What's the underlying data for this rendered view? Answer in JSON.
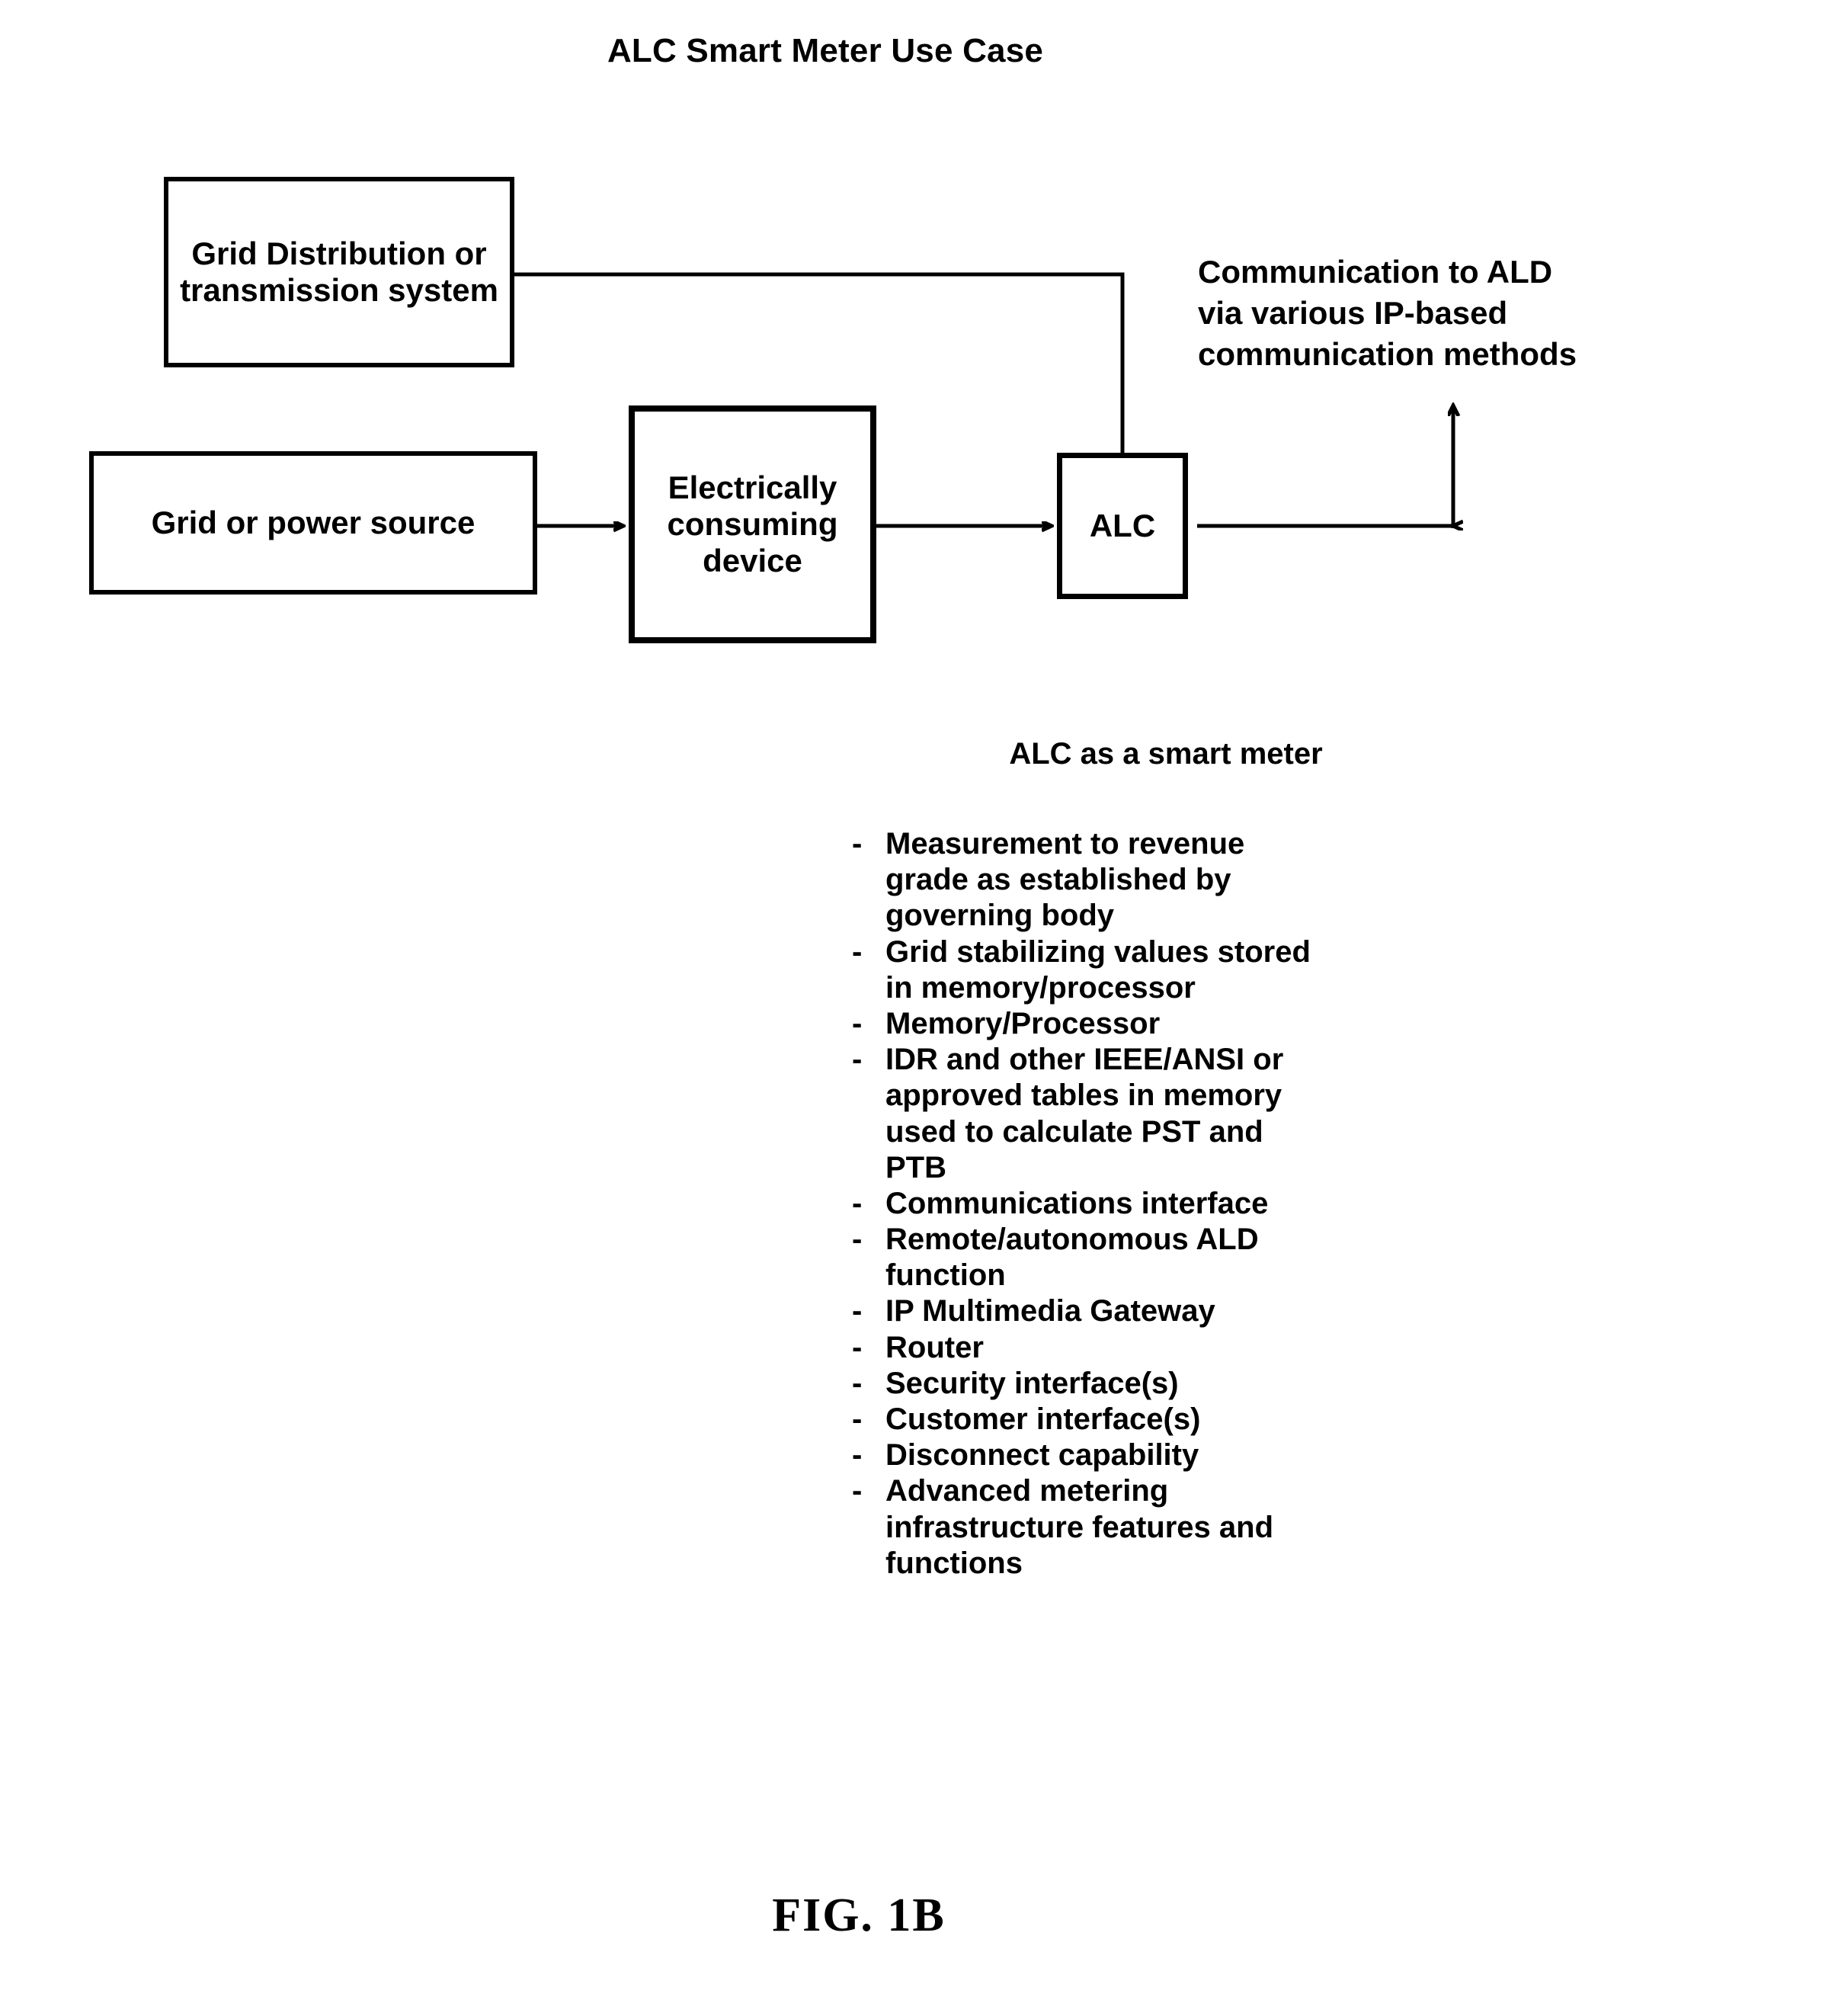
{
  "figure": {
    "title": "ALC Smart Meter Use Case",
    "caption": "FIG. 1B"
  },
  "diagram": {
    "boxes": {
      "grid_distribution": "Grid Distribution or\ntransmission system",
      "power_source": "Grid or power source",
      "consuming_device": "Electrically\nconsuming\ndevice",
      "alc": "ALC"
    },
    "annotation": {
      "communication_note": "Communication to ALD\nvia various IP-based\ncommunication methods"
    },
    "colors": {
      "stroke": "#000000",
      "background": "#ffffff"
    }
  },
  "smart_meter": {
    "heading": "ALC as a smart meter",
    "bullet_marker": "-",
    "items": [
      "Measurement to revenue\ngrade as established by\ngoverning body",
      "Grid stabilizing values stored\nin memory/processor",
      "Memory/Processor",
      "IDR and other IEEE/ANSI or\napproved tables in memory\nused to calculate PST and\nPTB",
      "Communications interface",
      "Remote/autonomous ALD\nfunction",
      "IP Multimedia Gateway",
      "Router",
      "Security interface(s)",
      "Customer interface(s)",
      "Disconnect capability",
      "Advanced metering\ninfrastructure features and\nfunctions"
    ]
  }
}
